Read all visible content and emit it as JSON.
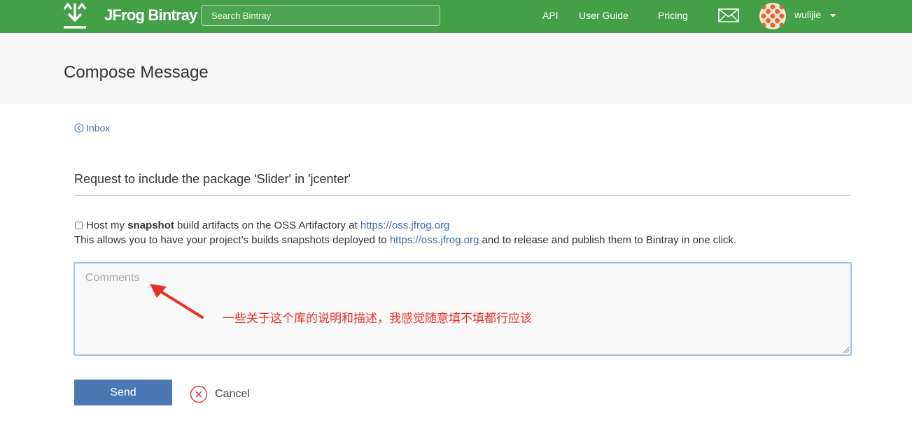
{
  "header": {
    "brand": "JFrog Bintray",
    "search_placeholder": "Search Bintray",
    "nav": {
      "api": "API",
      "user_guide": "User Guide",
      "pricing": "Pricing"
    },
    "username": "wulijie",
    "icons": [
      "download-logo-icon",
      "mail-icon",
      "avatar",
      "caret-down-icon"
    ],
    "accent_color": "#43a047"
  },
  "page": {
    "title": "Compose Message",
    "back_link": "Inbox",
    "subject": "Request to include the package 'Slider' in 'jcenter'"
  },
  "snapshot": {
    "checked": false,
    "text_before": "Host my ",
    "bold": "snapshot",
    "text_after": " build artifacts on the OSS Artifactory at ",
    "link": "https://oss.jfrog.org",
    "desc_before": "This allows you to have your project’s builds snapshots deployed to ",
    "desc_link": "https://oss.jfrog.org",
    "desc_after": " and to release and publish them to Bintray in one click."
  },
  "comments": {
    "placeholder": "Comments",
    "value": ""
  },
  "annotation": {
    "text": "一些关于这个库的说明和描述，我感觉随意填不填都行应该",
    "color": "#e8312a"
  },
  "actions": {
    "send": "Send",
    "cancel": "Cancel",
    "send_color": "#4a78b2"
  }
}
